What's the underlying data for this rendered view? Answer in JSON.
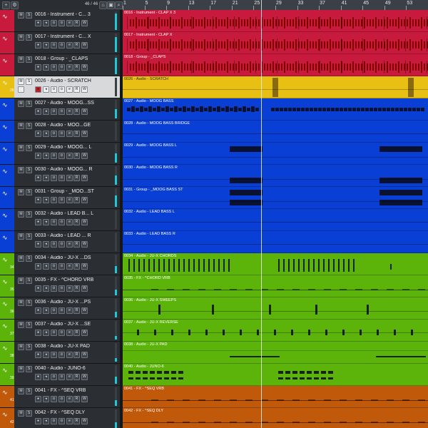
{
  "toolbar": {
    "add_icon": "plus-icon",
    "counter": "46 / 46",
    "buttons": [
      "home-icon",
      "window-icon",
      "search-icon"
    ]
  },
  "ruler": {
    "bars": [
      "1",
      "5",
      "9",
      "13",
      "17",
      "21",
      "25",
      "29",
      "33",
      "37",
      "41",
      "45",
      "49",
      "53"
    ],
    "playhead_bar": 25
  },
  "colors": {
    "red": "#c81a3c",
    "yellow": "#e8c014",
    "blue": "#0a3fd6",
    "green": "#5cb40a",
    "orange": "#c05a0a"
  },
  "tracks": [
    {
      "number": "",
      "name": "0016 - Instrument - C... 3",
      "clip": "0016 - Instrument - CLAP X 3",
      "color": "red",
      "pattern": "dense",
      "meter": 0.9,
      "selected": false
    },
    {
      "number": "",
      "name": "0017 - Instrument - C... X",
      "clip": "0017 - Instrument - CLAP X",
      "color": "red",
      "pattern": "dense",
      "meter": 0.8,
      "selected": false
    },
    {
      "number": "",
      "name": "0018 - Group - _CLAPS",
      "clip": "0018 - Group - _CLAPS",
      "color": "red",
      "pattern": "dense",
      "meter": 0.9,
      "selected": false
    },
    {
      "number": "28",
      "name": "0026 - Audio - SCRATCH",
      "clip": "0026 - Audio - SCRATCH",
      "color": "yellow",
      "pattern": "scratch",
      "meter": 0.0,
      "selected": true
    },
    {
      "number": "",
      "name": "0027 - Audio - MOOG...SS",
      "clip": "0027 - Audio - MOOG BASS",
      "color": "blue",
      "pattern": "moog",
      "meter": 0.5,
      "selected": false
    },
    {
      "number": "",
      "name": "0028 - Audio - MOO...GE",
      "clip": "0028 - Audio - MOOG BASS BRIDGE",
      "color": "blue",
      "pattern": "flat",
      "meter": 0.0,
      "selected": false
    },
    {
      "number": "",
      "name": "0029 - Audio - MOOG... L",
      "clip": "0029 - Audio - MOOG BASS L",
      "color": "blue",
      "pattern": "moogsplit",
      "meter": 0.5,
      "selected": false
    },
    {
      "number": "",
      "name": "0030 - Audio - MOOG... R",
      "clip": "0030 - Audio - MOOG BASS R",
      "color": "blue",
      "pattern": "moogsplit2",
      "meter": 0.5,
      "selected": false
    },
    {
      "number": "",
      "name": "0031 - Group - _MOO...ST",
      "clip": "0031 - Group - _MOOG BASS ST",
      "color": "blue",
      "pattern": "moogsplit3",
      "meter": 0.6,
      "selected": false
    },
    {
      "number": "",
      "name": "0032 - Audio - LEAD B... L",
      "clip": "0032 - Audio - LEAD BASS L",
      "color": "blue",
      "pattern": "flat",
      "meter": 0.0,
      "selected": false
    },
    {
      "number": "",
      "name": "0033 - Audio - LEAD ... R",
      "clip": "0033 - Audio - LEAD BASS R",
      "color": "blue",
      "pattern": "flat",
      "meter": 0.0,
      "selected": false
    },
    {
      "number": "34",
      "name": "0034 - Audio - JU-X ...DS",
      "clip": "0034 - Audio - JU-X CHORDS",
      "color": "green",
      "pattern": "chords",
      "meter": 0.4,
      "selected": false
    },
    {
      "number": "35",
      "name": "0035 - FX - ^CHORD VRB",
      "clip": "0035 - FX - ^CHORD VRB",
      "color": "green",
      "pattern": "thin",
      "meter": 0.3,
      "selected": false
    },
    {
      "number": "36",
      "name": "0036 - Audio - JU-X ...PS",
      "clip": "0036 - Audio - JU-X SWEEPS",
      "color": "green",
      "pattern": "sweeps",
      "meter": 0.3,
      "selected": false
    },
    {
      "number": "37",
      "name": "0037 - Audio - JU-X ...SE",
      "clip": "0037 - Audio - JU-X REVERSE",
      "color": "green",
      "pattern": "reverse",
      "meter": 0.2,
      "selected": false
    },
    {
      "number": "38",
      "name": "0038 - Audio - JU-X PAD",
      "clip": "0038 - Audio - JU-X PAD",
      "color": "green",
      "pattern": "pad",
      "meter": 0.2,
      "selected": false
    },
    {
      "number": "39",
      "name": "0040 - Audio - JUNO-6",
      "clip": "0040 - Audio - JUNO-6",
      "color": "green",
      "pattern": "juno",
      "meter": 0.4,
      "selected": false
    },
    {
      "number": "41",
      "name": "0041 - FX - ^SEQ VRB",
      "clip": "0041 - FX - ^SEQ VRB",
      "color": "orange",
      "pattern": "thin",
      "meter": 0.3,
      "selected": false
    },
    {
      "number": "42",
      "name": "0042 - FX - ^SEQ DLY",
      "clip": "0042 - FX - ^SEQ DLY",
      "color": "orange",
      "pattern": "thin",
      "meter": 0.3,
      "selected": false
    }
  ]
}
